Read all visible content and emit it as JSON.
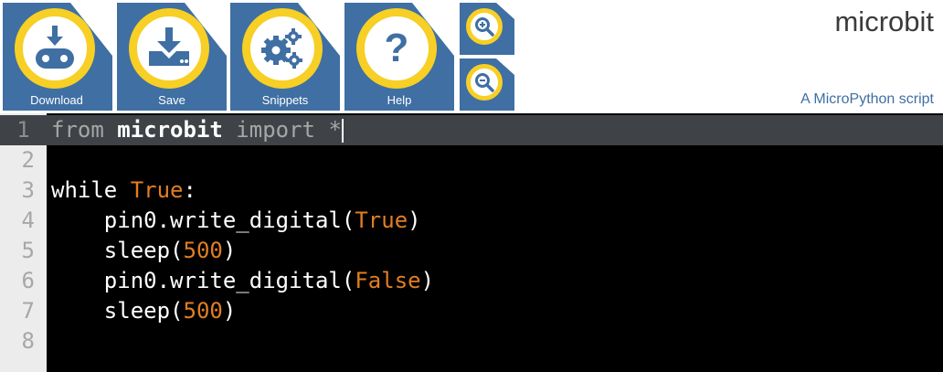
{
  "toolbar": {
    "buttons": [
      {
        "label": "Download",
        "icon": "download-microbit-icon"
      },
      {
        "label": "Save",
        "icon": "save-icon"
      },
      {
        "label": "Snippets",
        "icon": "gears-icon"
      },
      {
        "label": "Help",
        "icon": "help-icon",
        "glyph": "?"
      }
    ],
    "zoom_in": {
      "icon": "zoom-in-icon"
    },
    "zoom_out": {
      "icon": "zoom-out-icon"
    }
  },
  "header": {
    "title": "microbit",
    "subtitle": "A MicroPython script"
  },
  "editor": {
    "active_line": 1,
    "lines": [
      {
        "num": "1",
        "indent": "",
        "tokens": [
          [
            "kw",
            "from "
          ],
          [
            "bold",
            "microbit"
          ],
          [
            "kw",
            " import *"
          ]
        ]
      },
      {
        "num": "2",
        "indent": "",
        "tokens": []
      },
      {
        "num": "3",
        "indent": "",
        "tokens": [
          [
            "kw2",
            "while "
          ],
          [
            "bool",
            "True"
          ],
          [
            "kw2",
            ":"
          ]
        ]
      },
      {
        "num": "4",
        "indent": "    ",
        "tokens": [
          [
            "kw2",
            "pin0.write_digital("
          ],
          [
            "bool",
            "True"
          ],
          [
            "kw2",
            ")"
          ]
        ]
      },
      {
        "num": "5",
        "indent": "    ",
        "tokens": [
          [
            "kw2",
            "sleep("
          ],
          [
            "numlit",
            "500"
          ],
          [
            "kw2",
            ")"
          ]
        ]
      },
      {
        "num": "6",
        "indent": "    ",
        "tokens": [
          [
            "kw2",
            "pin0.write_digital("
          ],
          [
            "bool",
            "False"
          ],
          [
            "kw2",
            ")"
          ]
        ]
      },
      {
        "num": "7",
        "indent": "    ",
        "tokens": [
          [
            "kw2",
            "sleep("
          ],
          [
            "numlit",
            "500"
          ],
          [
            "kw2",
            ")"
          ]
        ]
      },
      {
        "num": "8",
        "indent": "",
        "tokens": []
      }
    ]
  },
  "colors": {
    "toolbar_blue": "#3f6fa3",
    "icon_ring_yellow": "#f7cf25",
    "editor_background": "#000000",
    "literal_orange": "#e07e22"
  }
}
